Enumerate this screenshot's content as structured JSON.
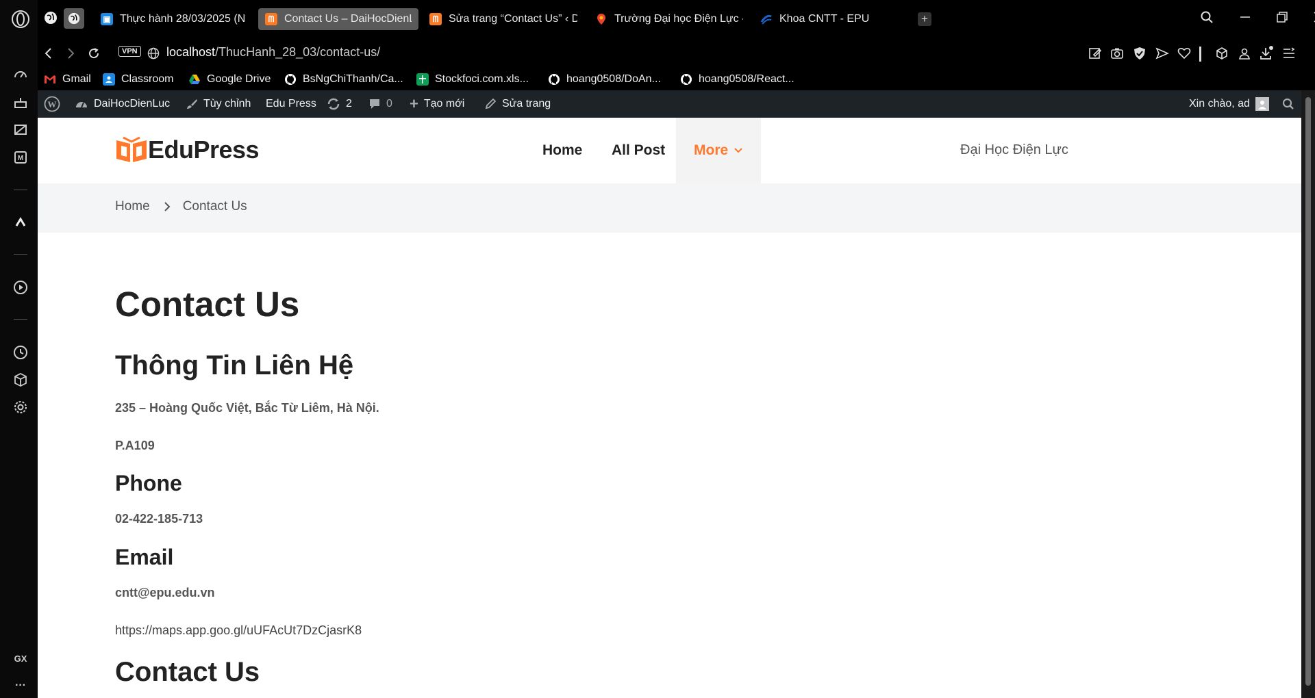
{
  "browser": {
    "tabs": [
      {
        "label": "Thực hành 28/03/2025 (N",
        "icon": "classroom-icon"
      },
      {
        "label": "Contact Us – DaiHocDienL",
        "icon": "xampp-icon",
        "active": true
      },
      {
        "label": "Sửa trang “Contact Us” ‹ D",
        "icon": "xampp-icon"
      },
      {
        "label": "Trường Đại học Điện Lực -",
        "icon": "maps-pin-icon"
      },
      {
        "label": "Khoa CNTT - EPU",
        "icon": "epu-icon"
      }
    ],
    "new_tab": "+",
    "vpn_label": "VPN",
    "url_host": "localhost",
    "url_path": "/ThucHanh_28_03/contact-us/",
    "sidebar_bottom_label": "GX",
    "sidebar_more": "···"
  },
  "bookmarks": [
    {
      "label": "Gmail",
      "icon": "gmail-icon",
      "color": "#ea4335"
    },
    {
      "label": "Classroom",
      "icon": "classroom-icon",
      "color": "#1e88e5"
    },
    {
      "label": "Google Drive",
      "icon": "drive-icon",
      "color": "#fbbc04"
    },
    {
      "label": "BsNgChiThanh/Ca...",
      "icon": "github-icon",
      "color": "#ffffff"
    },
    {
      "label": "Stockfoci.com.xls...",
      "icon": "sheets-icon",
      "color": "#0f9d58"
    },
    {
      "label": "hoang0508/DoAn...",
      "icon": "github-icon",
      "color": "#ffffff"
    },
    {
      "label": "hoang0508/React...",
      "icon": "github-icon",
      "color": "#ffffff"
    }
  ],
  "wp_admin_bar": {
    "site_name": "DaiHocDienLuc",
    "customize": "Tùy chỉnh",
    "theme": "Edu Press",
    "updates_count": "2",
    "comments_count": "0",
    "new": "Tạo mới",
    "edit": "Sửa trang",
    "greeting": "Xin chào, ad"
  },
  "site": {
    "logo_text": "EduPress",
    "brand_color": "#ff782d",
    "menu": [
      "Home",
      "All Post",
      "More"
    ],
    "tagline": "Đại Học Điện Lực",
    "breadcrumb": [
      "Home",
      "Contact Us"
    ]
  },
  "content": {
    "page_title": "Contact Us",
    "info_heading": "Thông Tin Liên Hệ",
    "address": "235 – Hoàng Quốc Việt, Bắc Từ Liêm, Hà Nội.",
    "room": "P.A109",
    "phone_heading": "Phone",
    "phone": "02-422-185-713",
    "email_heading": "Email",
    "email": "cntt@epu.edu.vn",
    "map_link": "https://maps.app.goo.gl/uUFAcUt7DzCjasrK8",
    "form_heading": "Contact Us"
  }
}
